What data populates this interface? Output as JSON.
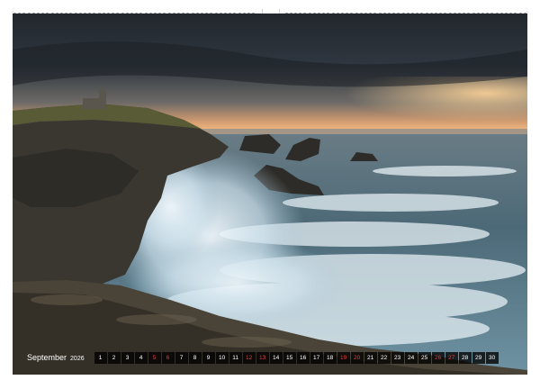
{
  "calendar": {
    "month": "September",
    "year": "2026",
    "days": [
      "1",
      "2",
      "3",
      "4",
      "5",
      "6",
      "7",
      "8",
      "9",
      "10",
      "11",
      "12",
      "13",
      "14",
      "15",
      "16",
      "17",
      "18",
      "19",
      "20",
      "21",
      "22",
      "23",
      "24",
      "25",
      "26",
      "27",
      "28",
      "29",
      "30"
    ],
    "weekend_days": [
      "5",
      "6",
      "12",
      "13",
      "19",
      "20",
      "26",
      "27"
    ]
  },
  "photo": {
    "subject": "coastal-storm-waves",
    "colors": {
      "sky_top": "#23282e",
      "horizon": "#f0b27a",
      "sea": "#4a6a7a",
      "foam": "#e8f2f8",
      "rock": "#3b3a33"
    }
  }
}
